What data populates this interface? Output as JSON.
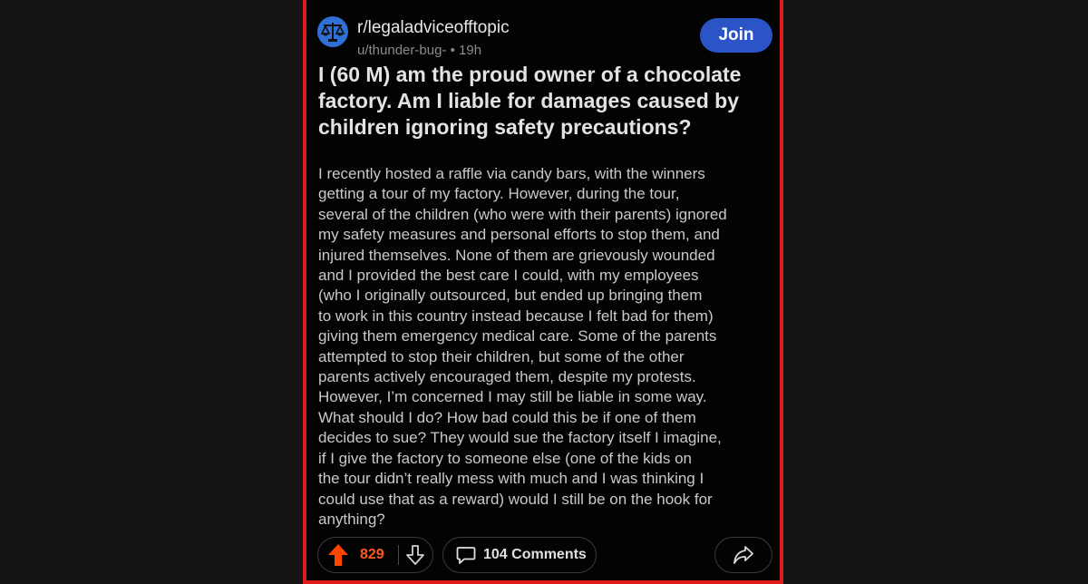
{
  "post": {
    "subreddit": "r/legaladviceofftopic",
    "author": "u/thunder-bug-",
    "separator": "•",
    "age": "19h",
    "join_label": "Join",
    "title": "I (60 M) am the proud owner of a chocolate factory. Am I liable for damages caused by children ignoring safety precautions?",
    "body_lines": [
      "I recently hosted a raffle via candy bars, with the winners",
      "getting a tour of my factory. However, during the tour,",
      "several of the children (who were with their parents) ignored",
      "my safety measures and personal efforts to stop them, and",
      "injured themselves. None of them are grievously wounded",
      "and I provided the best care I could, with my employees",
      "(who I originally outsourced, but ended up bringing them",
      "to work in this country instead because I felt bad for them)",
      "giving them emergency medical care. Some of the parents",
      "attempted to stop their children, but some of the other",
      "parents actively encouraged them, despite my protests.",
      "However, I’m concerned I may still be liable in some way.",
      "What should I do? How bad could this be if one of them",
      "decides to sue? They would sue the factory itself I imagine,",
      "if I give the factory to someone else (one of the kids on",
      "the tour didn’t really mess with much and I was thinking I",
      "could use that as a reward) would I still be on the hook for",
      "anything?"
    ],
    "score": "829",
    "comments_label": "104 Comments"
  },
  "colors": {
    "frame_border": "#e11b1b",
    "background": "#030303",
    "join_button": "#2b54c7",
    "upvote_active": "#ff5a1f",
    "avatar": "#2f6fd6"
  },
  "icons": {
    "avatar": "scales-of-justice-icon",
    "upvote": "arrow-up-icon",
    "downvote": "arrow-down-icon",
    "comments": "speech-bubble-icon",
    "share": "share-arrow-icon"
  }
}
